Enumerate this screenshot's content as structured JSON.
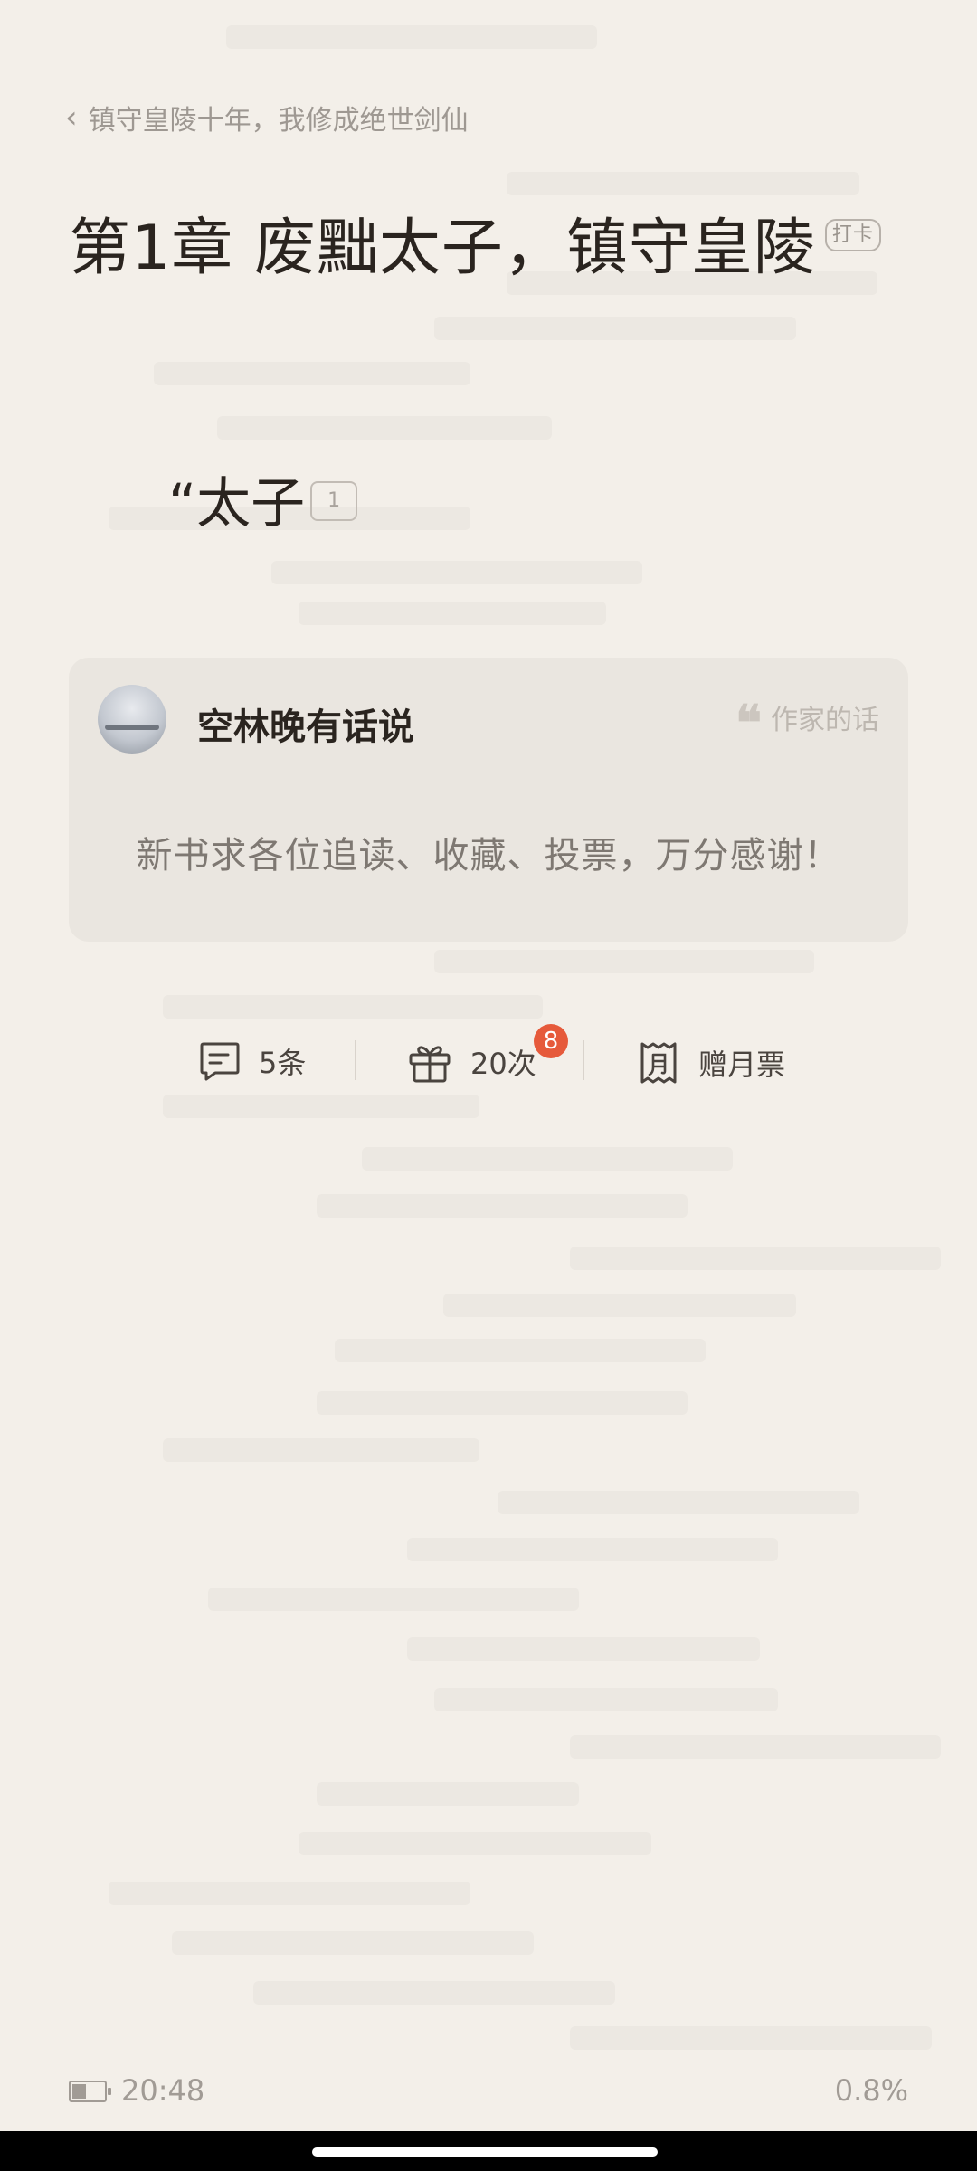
{
  "header": {
    "back_icon": "chevron-left-icon",
    "book_title": "镇守皇陵十年，我修成绝世剑仙"
  },
  "chapter": {
    "title": "第1章 废黜太子，镇守皇陵",
    "checkin_tag": "打卡"
  },
  "content": {
    "first_paragraph": "“太子",
    "paragraph_comment_count": "1"
  },
  "author_note": {
    "avatar_icon": "author-avatar",
    "author_name": "空林晚有话说",
    "label": "作家的话",
    "quote_icon": "❝",
    "message": "新书求各位追读、收藏、投票，万分感谢！"
  },
  "actions": {
    "comments_label": "5条",
    "gift_label": "20次",
    "gift_badge": "8",
    "ticket_label": "赠月票",
    "badge_color": "#e65a3b"
  },
  "status": {
    "time": "20:48",
    "progress": "0.8%",
    "battery_level": 0.45
  },
  "theme": {
    "background": "#f3efe9",
    "card_background": "#eae6e0"
  }
}
